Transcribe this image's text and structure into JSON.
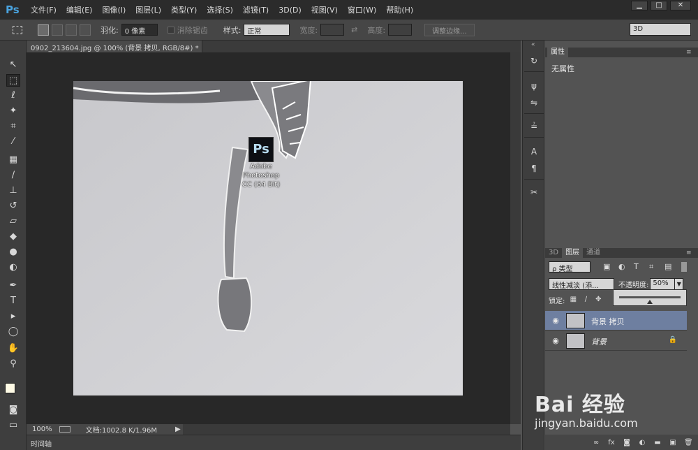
{
  "app": {
    "logo": "Ps",
    "menu": [
      "文件(F)",
      "编辑(E)",
      "图像(I)",
      "图层(L)",
      "类型(Y)",
      "选择(S)",
      "滤镜(T)",
      "3D(D)",
      "视图(V)",
      "窗口(W)",
      "帮助(H)"
    ],
    "window_controls": [
      "▁",
      "□",
      "✕"
    ]
  },
  "options": {
    "feather_label": "羽化:",
    "feather_value": "0 像素",
    "antialias_label": "消除锯齿",
    "style_label": "样式:",
    "style_value": "正常",
    "width_label": "宽度:",
    "height_label": "高度:",
    "refine_button": "调整边缘...",
    "workspace": "3D"
  },
  "document": {
    "tab_title": "0902_213604.jpg @ 100% (背景 拷贝, RGB/8#) *",
    "tab_close": "×",
    "zoom": "100%",
    "doc_size": "文档:1002.8 K/1.96M",
    "timeline_label": "时间轴"
  },
  "desktop_icon": {
    "tile": "Ps",
    "label_lines": [
      "Adobe",
      "Photoshop",
      "CC (64 Bit)"
    ]
  },
  "properties": {
    "tab": "属性",
    "empty_text": "无属性"
  },
  "layers_panel": {
    "tabs": [
      "3D",
      "图层",
      "通道"
    ],
    "active_tab": "图层",
    "filter_kind": "ρ 类型",
    "blend_mode": "线性减淡 (添...",
    "opacity_label": "不透明度:",
    "opacity_value": "50%",
    "opacity": 0.5,
    "lock_label": "锁定:",
    "layers": [
      {
        "name": "背景 拷贝",
        "selected": true,
        "locked": false
      },
      {
        "name": "背景",
        "selected": false,
        "locked": true
      }
    ]
  },
  "watermark": {
    "brand": "Bai 经验",
    "url": "jingyan.baidu.com"
  }
}
